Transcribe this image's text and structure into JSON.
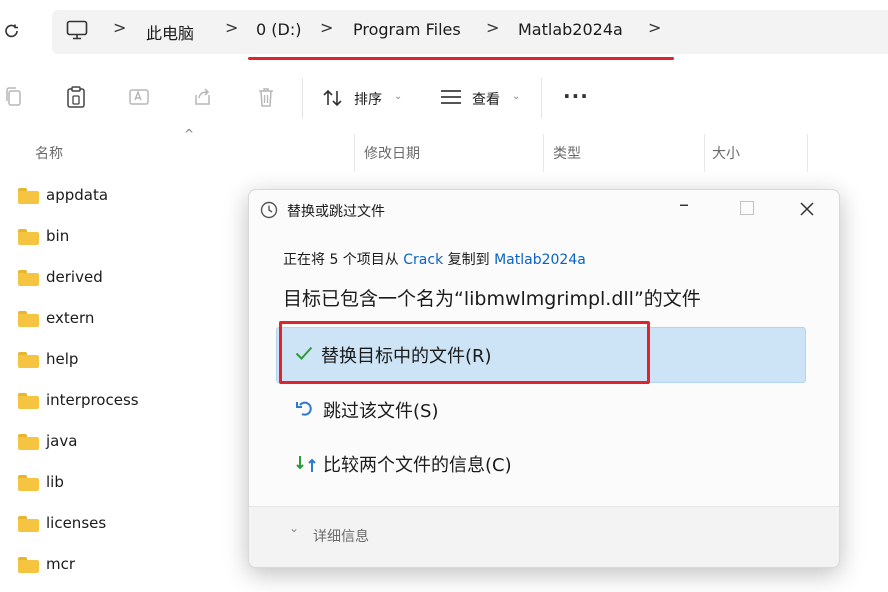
{
  "address_bar": {
    "refresh_icon": "refresh-icon",
    "computer_icon": "monitor-icon",
    "crumbs": [
      "此电脑",
      "0 (D:)",
      "Program Files",
      "Matlab2024a"
    ],
    "separator": ">"
  },
  "toolbar": {
    "sort_label": "排序",
    "view_label": "查看",
    "more_label": "···",
    "icons": [
      "copy-icon",
      "paste-icon",
      "rename-icon",
      "share-icon",
      "delete-icon",
      "sort-icon",
      "view-icon"
    ]
  },
  "columns": {
    "name": "名称",
    "modified": "修改日期",
    "type": "类型",
    "size": "大小"
  },
  "files": [
    "appdata",
    "bin",
    "derived",
    "extern",
    "help",
    "interprocess",
    "java",
    "lib",
    "licenses",
    "mcr"
  ],
  "dialog": {
    "title": "替换或跳过文件",
    "copying_prefix": "正在将 5 个项目从",
    "source": "Crack",
    "copying_mid": "复制到",
    "destination": "Matlab2024a",
    "message": "目标已包含一个名为“libmwlmgrimpl.dll”的文件",
    "option_replace": "替换目标中的文件(R)",
    "option_skip": "跳过该文件(S)",
    "option_compare": "比较两个文件的信息(C)",
    "details": "详细信息",
    "accent": "#0a64c2",
    "highlight": "#e0242e"
  }
}
